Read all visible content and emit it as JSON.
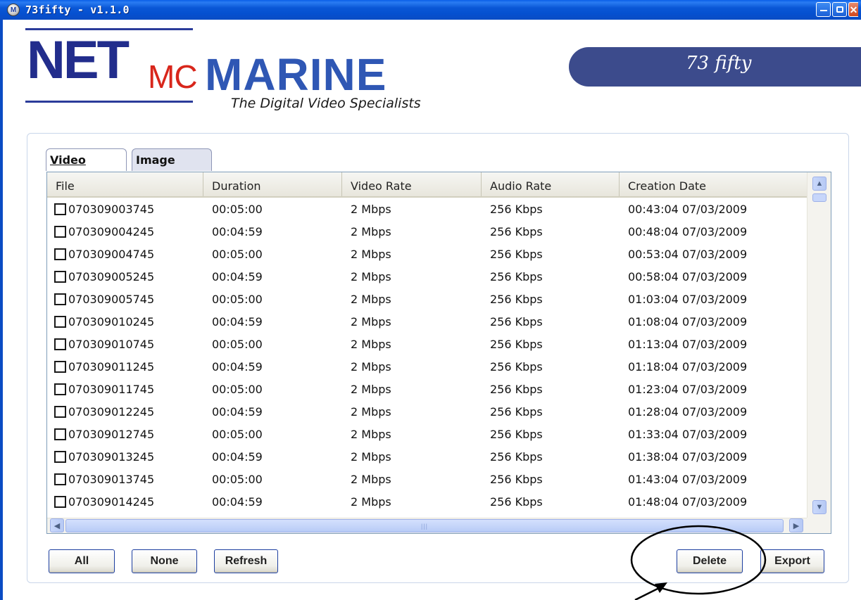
{
  "window": {
    "title": "73fifty - v1.1.0",
    "icon": "app-globe-icon",
    "controls": [
      "minimize-icon",
      "maximize-icon",
      "close-icon"
    ]
  },
  "logo": {
    "part1": "NET",
    "part2": "MC",
    "part3": "MARINE",
    "tagline": "The Digital Video Specialists",
    "colors": {
      "net": "#222d8c",
      "mc": "#d8261b",
      "marine": "#2f57b4"
    }
  },
  "banner": {
    "text": "73 fifty",
    "color": "#3c4b8c"
  },
  "tabs": [
    {
      "label": "Video",
      "active": true
    },
    {
      "label": "Image",
      "active": false
    }
  ],
  "table": {
    "columns": [
      "File",
      "Duration",
      "Video Rate",
      "Audio Rate",
      "Creation Date"
    ],
    "rows": [
      {
        "file": "070309003745",
        "duration": "00:05:00",
        "video_rate": "2 Mbps",
        "audio_rate": "256 Kbps",
        "created": "00:43:04 07/03/2009",
        "checked": false
      },
      {
        "file": "070309004245",
        "duration": "00:04:59",
        "video_rate": "2 Mbps",
        "audio_rate": "256 Kbps",
        "created": "00:48:04 07/03/2009",
        "checked": false
      },
      {
        "file": "070309004745",
        "duration": "00:05:00",
        "video_rate": "2 Mbps",
        "audio_rate": "256 Kbps",
        "created": "00:53:04 07/03/2009",
        "checked": false
      },
      {
        "file": "070309005245",
        "duration": "00:04:59",
        "video_rate": "2 Mbps",
        "audio_rate": "256 Kbps",
        "created": "00:58:04 07/03/2009",
        "checked": false
      },
      {
        "file": "070309005745",
        "duration": "00:05:00",
        "video_rate": "2 Mbps",
        "audio_rate": "256 Kbps",
        "created": "01:03:04 07/03/2009",
        "checked": false
      },
      {
        "file": "070309010245",
        "duration": "00:04:59",
        "video_rate": "2 Mbps",
        "audio_rate": "256 Kbps",
        "created": "01:08:04 07/03/2009",
        "checked": false
      },
      {
        "file": "070309010745",
        "duration": "00:05:00",
        "video_rate": "2 Mbps",
        "audio_rate": "256 Kbps",
        "created": "01:13:04 07/03/2009",
        "checked": false
      },
      {
        "file": "070309011245",
        "duration": "00:04:59",
        "video_rate": "2 Mbps",
        "audio_rate": "256 Kbps",
        "created": "01:18:04 07/03/2009",
        "checked": false
      },
      {
        "file": "070309011745",
        "duration": "00:05:00",
        "video_rate": "2 Mbps",
        "audio_rate": "256 Kbps",
        "created": "01:23:04 07/03/2009",
        "checked": false
      },
      {
        "file": "070309012245",
        "duration": "00:04:59",
        "video_rate": "2 Mbps",
        "audio_rate": "256 Kbps",
        "created": "01:28:04 07/03/2009",
        "checked": false
      },
      {
        "file": "070309012745",
        "duration": "00:05:00",
        "video_rate": "2 Mbps",
        "audio_rate": "256 Kbps",
        "created": "01:33:04 07/03/2009",
        "checked": false
      },
      {
        "file": "070309013245",
        "duration": "00:04:59",
        "video_rate": "2 Mbps",
        "audio_rate": "256 Kbps",
        "created": "01:38:04 07/03/2009",
        "checked": false
      },
      {
        "file": "070309013745",
        "duration": "00:05:00",
        "video_rate": "2 Mbps",
        "audio_rate": "256 Kbps",
        "created": "01:43:04 07/03/2009",
        "checked": false
      },
      {
        "file": "070309014245",
        "duration": "00:04:59",
        "video_rate": "2 Mbps",
        "audio_rate": "256 Kbps",
        "created": "01:48:04 07/03/2009",
        "checked": false
      }
    ]
  },
  "buttons": {
    "all": "All",
    "none": "None",
    "refresh": "Refresh",
    "delete": "Delete",
    "export": "Export"
  },
  "annotation": {
    "shape": "ellipse-with-arrow",
    "highlights": "delete-button",
    "color": "#000000"
  }
}
